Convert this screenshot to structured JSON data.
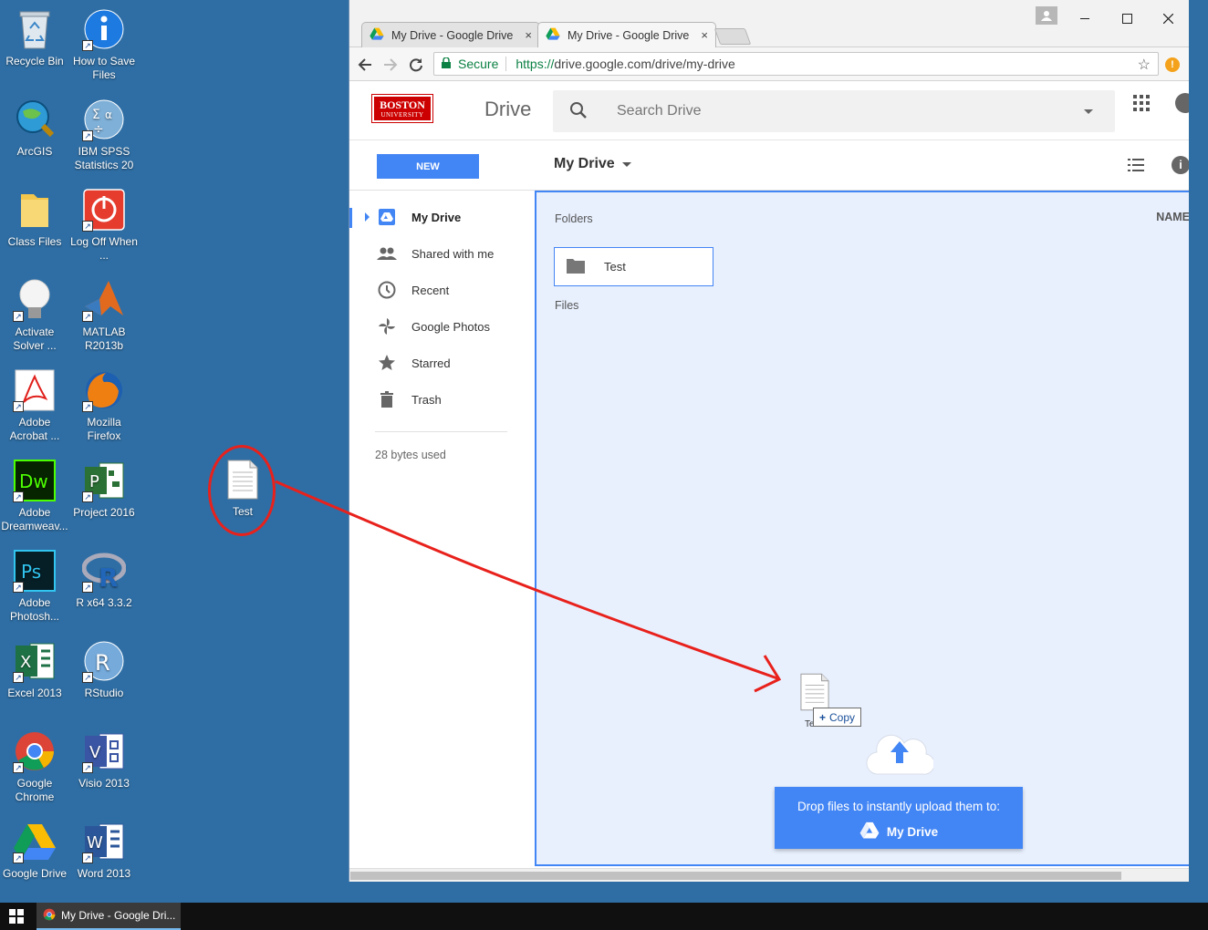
{
  "desktop": {
    "icons": [
      {
        "label": "Recycle Bin",
        "icon": "recycle-bin-icon"
      },
      {
        "label": "How to Save Files",
        "icon": "info-icon"
      },
      {
        "label": "ArcGIS",
        "icon": "arcgis-icon"
      },
      {
        "label": "IBM SPSS Statistics 20",
        "icon": "spss-icon"
      },
      {
        "label": "Class Files",
        "icon": "folder-icon"
      },
      {
        "label": "Log Off When ...",
        "icon": "power-icon"
      },
      {
        "label": "Activate Solver ...",
        "icon": "lightbulb-icon"
      },
      {
        "label": "MATLAB R2013b",
        "icon": "matlab-icon"
      },
      {
        "label": "Adobe Acrobat ...",
        "icon": "acrobat-icon"
      },
      {
        "label": "Mozilla Firefox",
        "icon": "firefox-icon"
      },
      {
        "label": "Adobe Dreamweav...",
        "icon": "dreamweaver-icon"
      },
      {
        "label": "Project 2016",
        "icon": "project-icon"
      },
      {
        "label": "Adobe Photosh...",
        "icon": "photoshop-icon"
      },
      {
        "label": "R x64 3.3.2",
        "icon": "r-icon"
      },
      {
        "label": "Excel 2013",
        "icon": "excel-icon"
      },
      {
        "label": "RStudio",
        "icon": "rstudio-icon"
      },
      {
        "label": "Google Chrome",
        "icon": "chrome-icon"
      },
      {
        "label": "Visio 2013",
        "icon": "visio-icon"
      },
      {
        "label": "Google Drive",
        "icon": "google-drive-icon"
      },
      {
        "label": "Word 2013",
        "icon": "word-icon"
      }
    ],
    "test_file_label": "Test"
  },
  "browser": {
    "tabs": [
      {
        "title": "My Drive - Google Drive",
        "close": "×"
      },
      {
        "title": "My Drive - Google Drive",
        "close": "×"
      }
    ],
    "secure_label": "Secure",
    "url_scheme": "https://",
    "url_rest": "drive.google.com/drive/my-drive"
  },
  "drive": {
    "logo_line1": "BOSTON",
    "logo_line2": "UNIVERSITY",
    "app_title": "Drive",
    "search_placeholder": "Search Drive",
    "new_button": "NEW",
    "breadcrumb": "My Drive",
    "sidebar": [
      {
        "label": "My Drive",
        "icon": "my-drive-icon"
      },
      {
        "label": "Shared with me",
        "icon": "people-icon"
      },
      {
        "label": "Recent",
        "icon": "clock-icon"
      },
      {
        "label": "Google Photos",
        "icon": "photos-pinwheel-icon"
      },
      {
        "label": "Starred",
        "icon": "star-icon"
      },
      {
        "label": "Trash",
        "icon": "trash-icon"
      }
    ],
    "storage": "28 bytes used",
    "folders_label": "Folders",
    "files_label": "Files",
    "name_column": "NAME",
    "folders": [
      {
        "name": "Test"
      }
    ],
    "drag": {
      "caption": "Test",
      "badge": "Copy"
    },
    "drop_banner": {
      "line1": "Drop files to instantly upload them to:",
      "target": "My Drive"
    }
  },
  "taskbar": {
    "item": "My Drive - Google Dri..."
  },
  "colors": {
    "desktop": "#2f6ea4",
    "drive_blue": "#4285f4",
    "annotation_red": "#e8211c",
    "secure_green": "#0b8043"
  }
}
